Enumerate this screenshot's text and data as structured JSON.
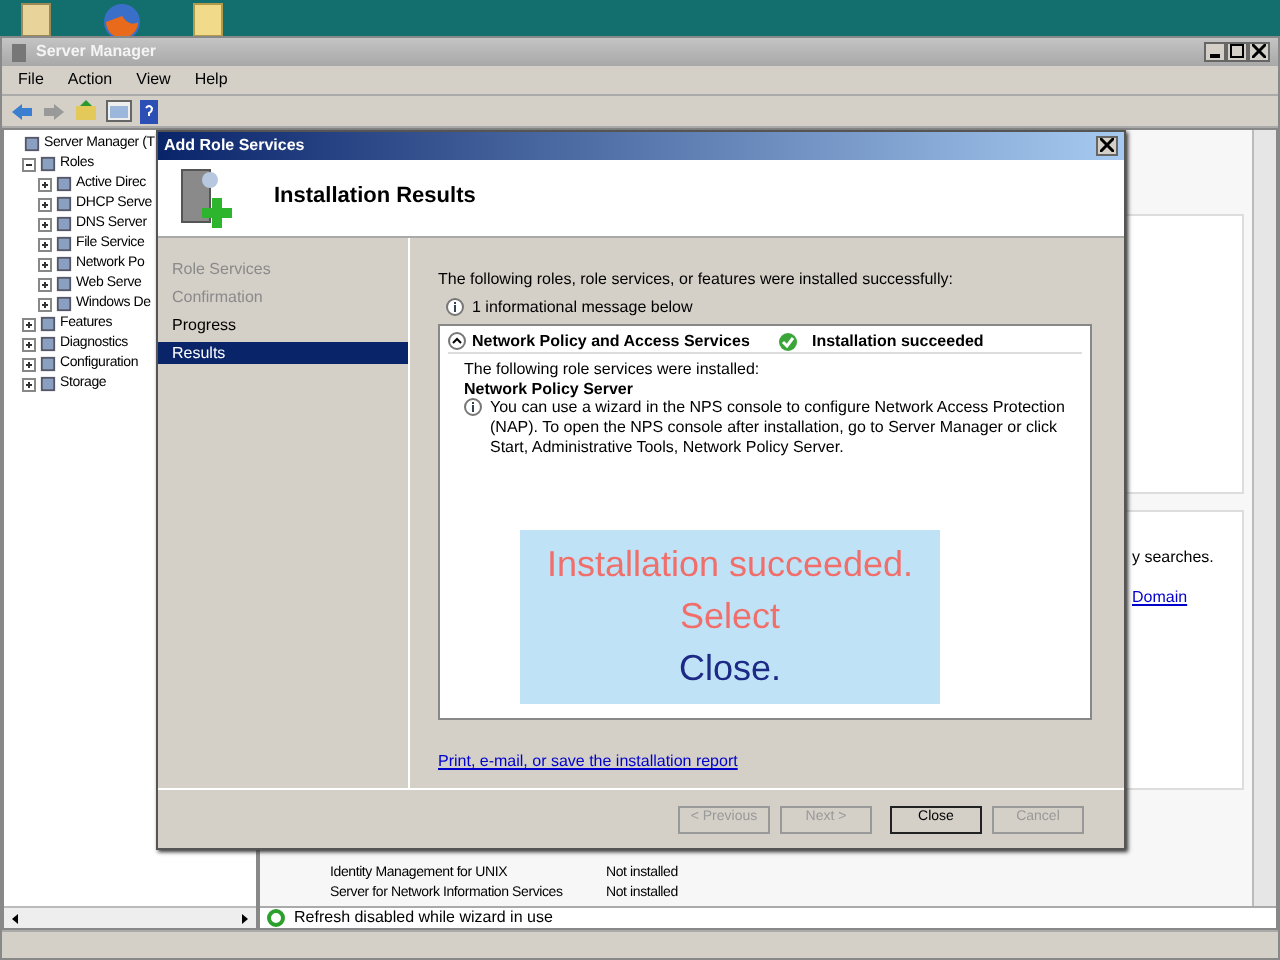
{
  "window": {
    "title": "Server Manager"
  },
  "menu": [
    "File",
    "Action",
    "View",
    "Help"
  ],
  "tree": [
    {
      "label": "Server Manager (T",
      "children": [
        {
          "label": "Roles",
          "expanded": true,
          "children": [
            {
              "label": "Active Direc",
              "expanded": false
            },
            {
              "label": "DHCP Serve",
              "expanded": false
            },
            {
              "label": "DNS Server",
              "expanded": false
            },
            {
              "label": "File Service",
              "expanded": false
            },
            {
              "label": "Network Po",
              "expanded": false
            },
            {
              "label": "Web Serve",
              "expanded": false
            },
            {
              "label": "Windows De",
              "expanded": false
            }
          ]
        },
        {
          "label": "Features",
          "expanded": false
        },
        {
          "label": "Diagnostics",
          "expanded": false
        },
        {
          "label": "Configuration",
          "expanded": false
        },
        {
          "label": "Storage",
          "expanded": false
        }
      ]
    }
  ],
  "details": {
    "note": "y searches.",
    "link": "Domain",
    "rows": [
      {
        "name": "Identity Management for UNIX",
        "status": "Not installed"
      },
      {
        "name": "Server for Network Information Services",
        "status": "Not installed"
      }
    ],
    "status": "Refresh disabled while wizard in use"
  },
  "dialog": {
    "title": "Add Role Services",
    "heading": "Installation Results",
    "steps": [
      {
        "label": "Role Services",
        "selected": false,
        "disabled": true
      },
      {
        "label": "Confirmation",
        "selected": false,
        "disabled": true
      },
      {
        "label": "Progress",
        "selected": false,
        "disabled": false
      },
      {
        "label": "Results",
        "selected": true,
        "disabled": false
      }
    ],
    "intro": "The following roles, role services, or features were installed successfully:",
    "legend": "1 informational message below",
    "results": [
      {
        "role": "Network Policy and Access Services",
        "expanded": true,
        "status": "Installation succeeded",
        "installed_label": "The following role services were installed:",
        "services": [
          "Network Policy Server"
        ],
        "message": "You can use a wizard in the NPS console to configure Network Access Protection (NAP). To open the NPS console after installation, go to Server Manager or click Start, Administrative Tools, Network Policy Server."
      }
    ],
    "report_link": "Print, e-mail, or save the installation report",
    "buttons": [
      {
        "label": "< Previous",
        "disabled": true
      },
      {
        "label": "Next >",
        "disabled": true
      },
      {
        "label": "Close",
        "disabled": false
      },
      {
        "label": "Cancel",
        "disabled": true
      }
    ]
  },
  "callout": {
    "text": "Installation succeeded. Select",
    "highlight": "Close."
  }
}
